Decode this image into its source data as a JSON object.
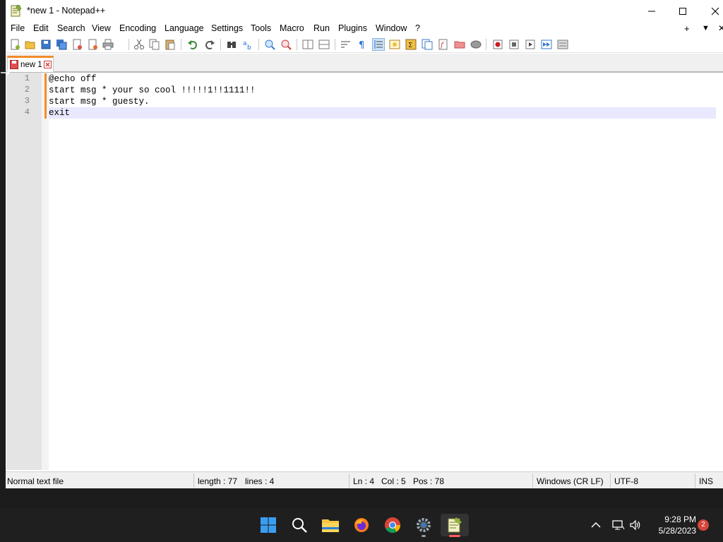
{
  "window": {
    "title": "*new 1 - Notepad++"
  },
  "menu": {
    "items": [
      "File",
      "Edit",
      "Search",
      "View",
      "Encoding",
      "Language",
      "Settings",
      "Tools",
      "Macro",
      "Run",
      "Plugins",
      "Window",
      "?"
    ],
    "right_add": "+",
    "right_dropdown": "▼",
    "right_close": "✕"
  },
  "tabs": [
    {
      "label": "new 1"
    }
  ],
  "editor": {
    "line_numbers": [
      "1",
      "2",
      "3",
      "4"
    ],
    "lines": [
      "@echo off",
      "start msg * your so cool !!!!!1!!1111!!",
      "start msg * guesty.",
      "exit"
    ]
  },
  "status": {
    "file_type": "Normal text file",
    "length": "length : 77",
    "lines": "lines : 4",
    "ln": "Ln : 4",
    "col": "Col : 5",
    "pos": "Pos : 78",
    "eol": "Windows (CR LF)",
    "encoding": "UTF-8",
    "mode": "INS"
  },
  "taskbar": {
    "time": "9:28 PM",
    "date": "5/28/2023",
    "notification_count": "2"
  },
  "colors": {
    "tab_accent": "#f28c28",
    "current_line": "#e8e8ff",
    "gutter": "#e4e4e4"
  }
}
